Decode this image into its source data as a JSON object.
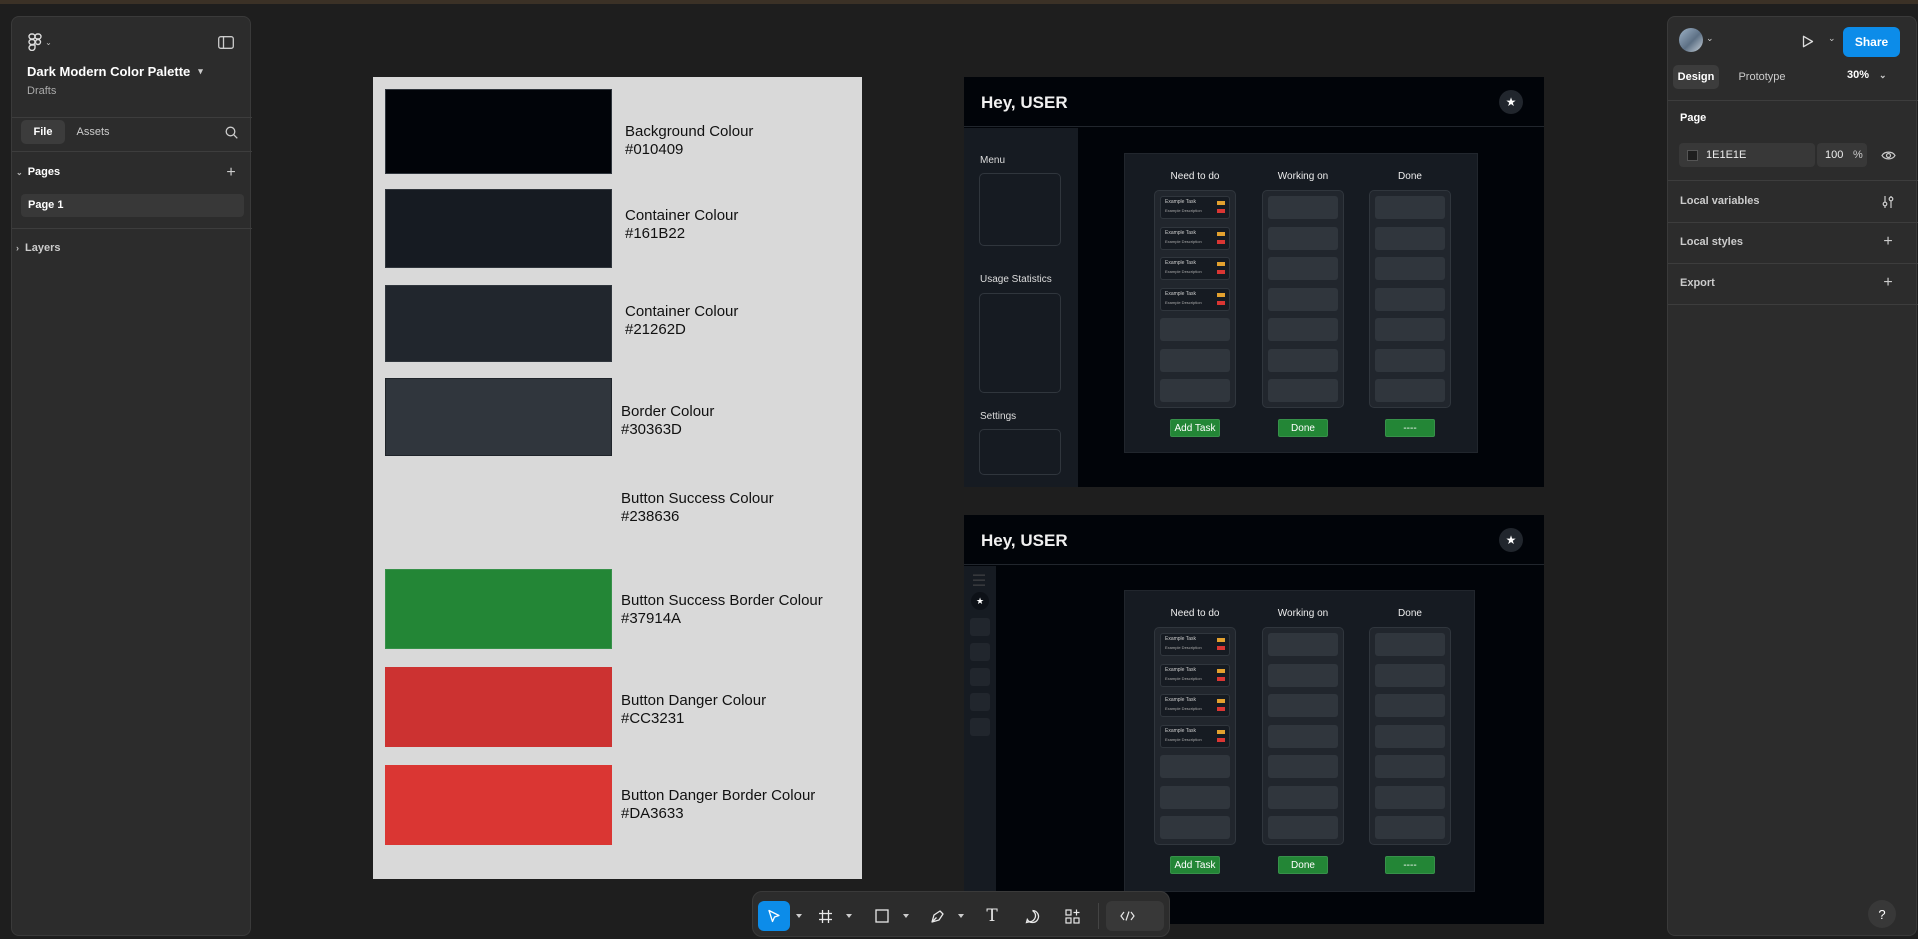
{
  "file": {
    "name": "Dark Modern Color Palette",
    "location": "Drafts"
  },
  "left_tabs": {
    "file": "File",
    "assets": "Assets"
  },
  "pages": {
    "heading": "Pages",
    "items": [
      {
        "label": "Page 1"
      }
    ]
  },
  "layers": {
    "heading": "Layers"
  },
  "right_tabs": {
    "design": "Design",
    "prototype": "Prototype",
    "zoom": "30%"
  },
  "share": {
    "label": "Share"
  },
  "page_section": {
    "heading": "Page",
    "color": "1E1E1E",
    "opacity": "100",
    "unit": "%"
  },
  "sections": {
    "local_variables": "Local variables",
    "local_styles": "Local styles",
    "export": "Export"
  },
  "palette": [
    {
      "name": "Background Colour",
      "hex": "#010409",
      "swatch": "#010409"
    },
    {
      "name": "Container Colour",
      "hex": "#161B22",
      "swatch": "#161b22"
    },
    {
      "name": "Container Colour",
      "hex": "#21262D",
      "swatch": "#21262d"
    },
    {
      "name": "Border Colour",
      "hex": "#30363D",
      "swatch": "#30363d"
    },
    {
      "name": "Button Success Colour",
      "hex": "#238636",
      "swatch": ""
    },
    {
      "name": "Button Success Border Colour",
      "hex": "#37914A",
      "swatch": "#238636"
    },
    {
      "name": "Button Danger Colour",
      "hex": "#CC3231",
      "swatch": "#cc3231"
    },
    {
      "name": "Button Danger Border Colour",
      "hex": "#DA3633",
      "swatch": "#da3633"
    }
  ],
  "dashboard_desktop": {
    "greeting": "Hey, USER",
    "menu": "Menu",
    "usage": "Usage Statistics",
    "settings": "Settings",
    "columns": [
      "Need to do",
      "Working on",
      "Done"
    ],
    "task_title": "Example Task",
    "task_desc": "Example Description",
    "buttons": [
      "Add Task",
      "Done",
      "----"
    ]
  },
  "dashboard_compact": {
    "greeting": "Hey, USER",
    "columns": [
      "Need to do",
      "Working on",
      "Done"
    ],
    "task_title": "Example Task",
    "task_desc": "Example Description",
    "buttons": [
      "Add Task",
      "Done",
      "----"
    ]
  },
  "help": {
    "label": "?"
  }
}
